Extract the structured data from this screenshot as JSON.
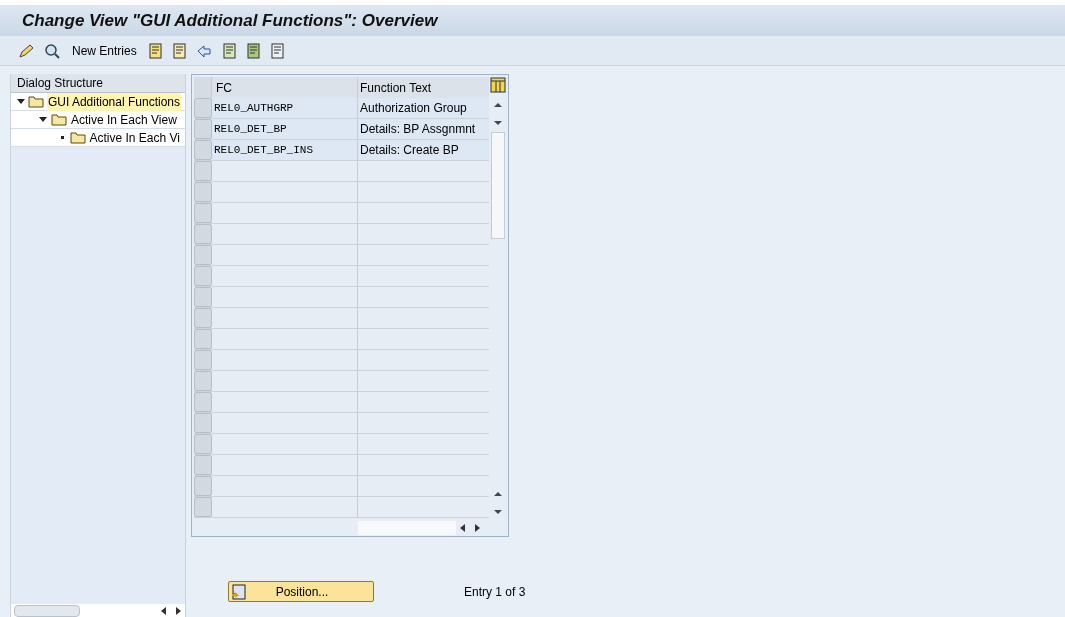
{
  "title": "Change View \"GUI Additional Functions\": Overview",
  "toolbar": {
    "new_entries": "New Entries"
  },
  "dialog_structure": {
    "header": "Dialog Structure",
    "items": [
      {
        "label": "GUI Additional Functions",
        "selected": true,
        "expanded": true,
        "children": [
          {
            "label": "Active In Each View",
            "selected": false,
            "expanded": true,
            "children": [
              {
                "label": "Active In Each Vi",
                "selected": false,
                "expanded": false
              }
            ]
          }
        ]
      }
    ]
  },
  "table": {
    "columns": [
      "FC",
      "Function Text"
    ],
    "rows": [
      [
        "REL0_AUTHGRP",
        "Authorization Group"
      ],
      [
        "REL0_DET_BP",
        "Details: BP Assgnmnt"
      ],
      [
        "REL0_DET_BP_INS",
        "Details: Create BP"
      ]
    ]
  },
  "position_button": "Position...",
  "entry_info": "Entry 1 of 3"
}
